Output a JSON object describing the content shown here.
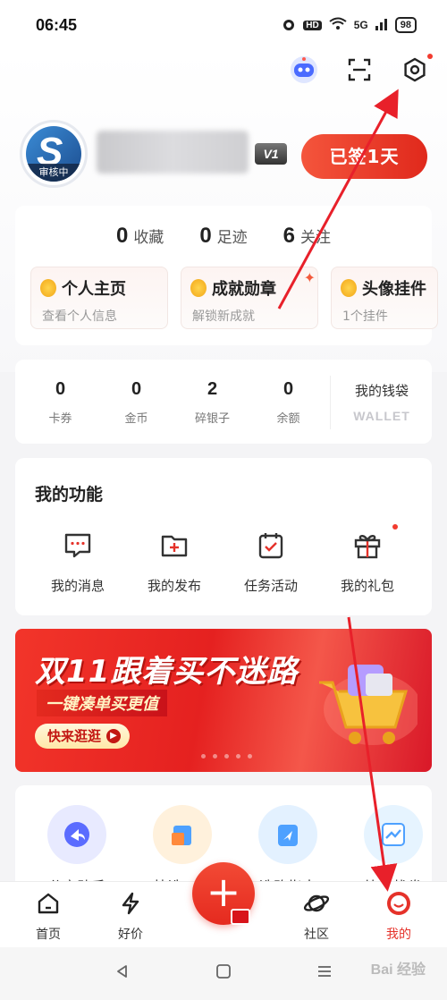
{
  "status_bar": {
    "time": "06:45",
    "hd": "HD",
    "signal": "5G",
    "battery": "98"
  },
  "profile": {
    "avatar_text": "S",
    "avatar_status": "审核中",
    "vip_level": "V1",
    "signin_label": "已签1天"
  },
  "stats": [
    {
      "value": "0",
      "label": "收藏"
    },
    {
      "value": "0",
      "label": "足迹"
    },
    {
      "value": "6",
      "label": "关注"
    }
  ],
  "quick_entries": [
    {
      "title": "个人主页",
      "subtitle": "查看个人信息"
    },
    {
      "title": "成就勋章",
      "subtitle": "解锁新成就"
    },
    {
      "title": "头像挂件",
      "subtitle": "1个挂件"
    }
  ],
  "wallet": {
    "items": [
      {
        "value": "0",
        "label": "卡券"
      },
      {
        "value": "0",
        "label": "金币"
      },
      {
        "value": "2",
        "label": "碎银子"
      },
      {
        "value": "0",
        "label": "余额"
      }
    ],
    "title": "我的钱袋",
    "subtitle": "WALLET"
  },
  "functions": {
    "title": "我的功能",
    "items": [
      {
        "label": "我的消息",
        "icon": "message-icon"
      },
      {
        "label": "我的发布",
        "icon": "publish-icon"
      },
      {
        "label": "任务活动",
        "icon": "task-icon"
      },
      {
        "label": "我的礼包",
        "icon": "gift-icon"
      }
    ]
  },
  "banner": {
    "title": "双11跟着买不迷路",
    "subtitle": "一键凑单买更值",
    "button": "快来逛逛"
  },
  "tools": [
    {
      "label": "分享助手",
      "icon": "share-icon",
      "color": "#e8eaff"
    },
    {
      "label": "快选工具",
      "icon": "bag-icon",
      "color": "#fff1dc"
    },
    {
      "label": "选购指南",
      "icon": "guide-icon",
      "color": "#e3f1ff"
    },
    {
      "label": "比价找券",
      "icon": "price-icon",
      "color": "#e6f4ff"
    }
  ],
  "tabbar": [
    {
      "label": "首页",
      "icon": "home-icon"
    },
    {
      "label": "好价",
      "icon": "deal-icon"
    },
    {
      "label": "",
      "icon": "plus-icon"
    },
    {
      "label": "社区",
      "icon": "planet-icon"
    },
    {
      "label": "我的",
      "icon": "profile-icon",
      "active": true
    }
  ],
  "watermark": "Bai 经验",
  "colors": {
    "accent": "#e5322a",
    "annotation": "#e8202a"
  }
}
